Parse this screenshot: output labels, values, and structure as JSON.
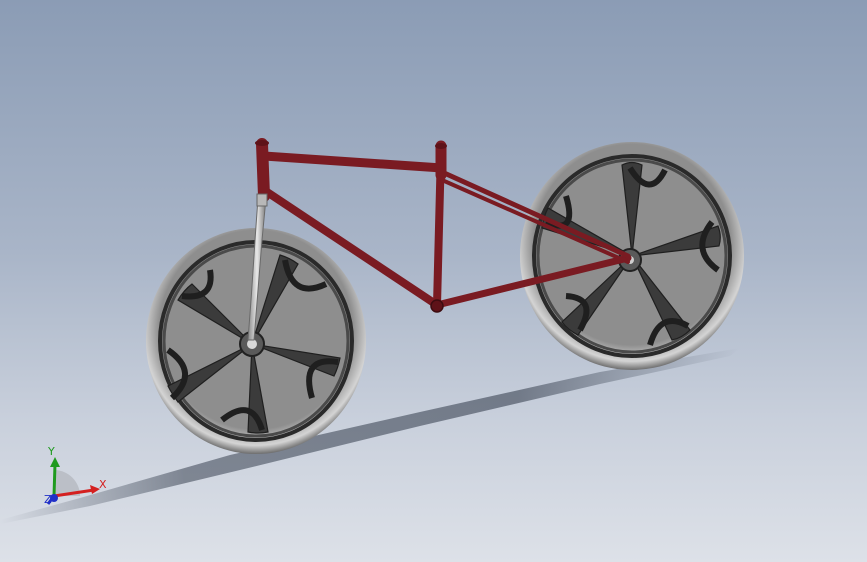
{
  "viewport": {
    "background_top": "#8b9cb5",
    "background_bottom": "#dde1e8"
  },
  "model": {
    "frame_color": "#7a1b22",
    "tire_color": "#a8a8a8",
    "rim_color": "#3a3a3a",
    "fork_color": "#c8c8c8"
  },
  "triad": {
    "x_label": "X",
    "y_label": "Y",
    "z_label": "Z",
    "x_color": "#d42020",
    "y_color": "#1e9a1e",
    "z_color": "#2030c8"
  }
}
